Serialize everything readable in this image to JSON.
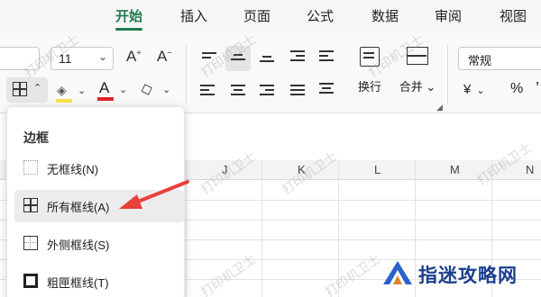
{
  "tabs": [
    {
      "label": "开始",
      "active": true
    },
    {
      "label": "插入",
      "active": false
    },
    {
      "label": "页面",
      "active": false
    },
    {
      "label": "公式",
      "active": false
    },
    {
      "label": "数据",
      "active": false
    },
    {
      "label": "审阅",
      "active": false
    },
    {
      "label": "视图",
      "active": false
    }
  ],
  "ribbon": {
    "font_size": "11",
    "grow_label": "A",
    "shrink_label": "A",
    "font_color_label": "A",
    "wrap_label": "换行",
    "merge_label": "合并",
    "number_format": "常规",
    "currency_symbol": "¥",
    "percent_symbol": "%",
    "comma_symbol": "’"
  },
  "grid": {
    "columns": [
      "J",
      "K",
      "L",
      "M",
      "N"
    ]
  },
  "border_menu": {
    "title": "边框",
    "items": [
      {
        "label": "无框线(N)",
        "icon": "no-border-icon"
      },
      {
        "label": "所有框线(A)",
        "icon": "all-borders-icon",
        "selected": true
      },
      {
        "label": "外侧框线(S)",
        "icon": "outside-borders-icon"
      },
      {
        "label": "粗匣框线(T)",
        "icon": "thick-box-border-icon"
      }
    ]
  },
  "watermark": "打印机卫士",
  "brand": {
    "name": "指迷攻略网"
  },
  "colors": {
    "accent": "#1f7a4d",
    "fill_color": "#f7e046",
    "font_color": "#e02424",
    "arrow": "#e8403a",
    "brand": "#1a3d8f"
  }
}
